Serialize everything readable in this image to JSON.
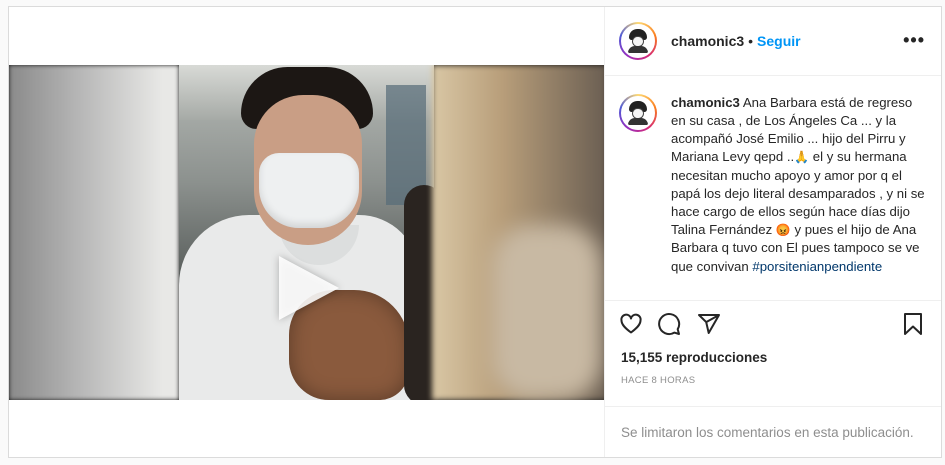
{
  "post": {
    "username": "chamonic3",
    "separator": "•",
    "follow_label": "Seguir",
    "more_label": "•••",
    "caption": {
      "username": "chamonic3",
      "text_1": "Ana Barbara está de regreso en su casa , de Los Ángeles Ca ... y la acompañó José Emilio ... hijo del Pirru y Mariana Levy qepd ..",
      "emoji_1": "🙏",
      "text_2": " el y su hermana necesitan mucho apoyo y amor por q el papá los dejo literal desamparados , y ni se hace cargo de ellos según hace días dijo Talina Fernández ",
      "emoji_2": "😡",
      "text_3": " y pues el hijo de Ana Barbara q tuvo con El pues tampoco se ve que convivan ",
      "hashtag": "#porsitenianpendiente"
    },
    "views": "15,155 reproducciones",
    "time": "HACE 8 HORAS",
    "comments_disabled": "Se limitaron los comentarios en esta publicación."
  },
  "icons": [
    "play-icon",
    "heart-icon",
    "comment-icon",
    "share-icon",
    "bookmark-icon",
    "more-icon"
  ],
  "colors": {
    "link": "#0095f6",
    "hashtag": "#00376b",
    "muted": "#8e8e8e",
    "border": "#dbdbdb"
  }
}
